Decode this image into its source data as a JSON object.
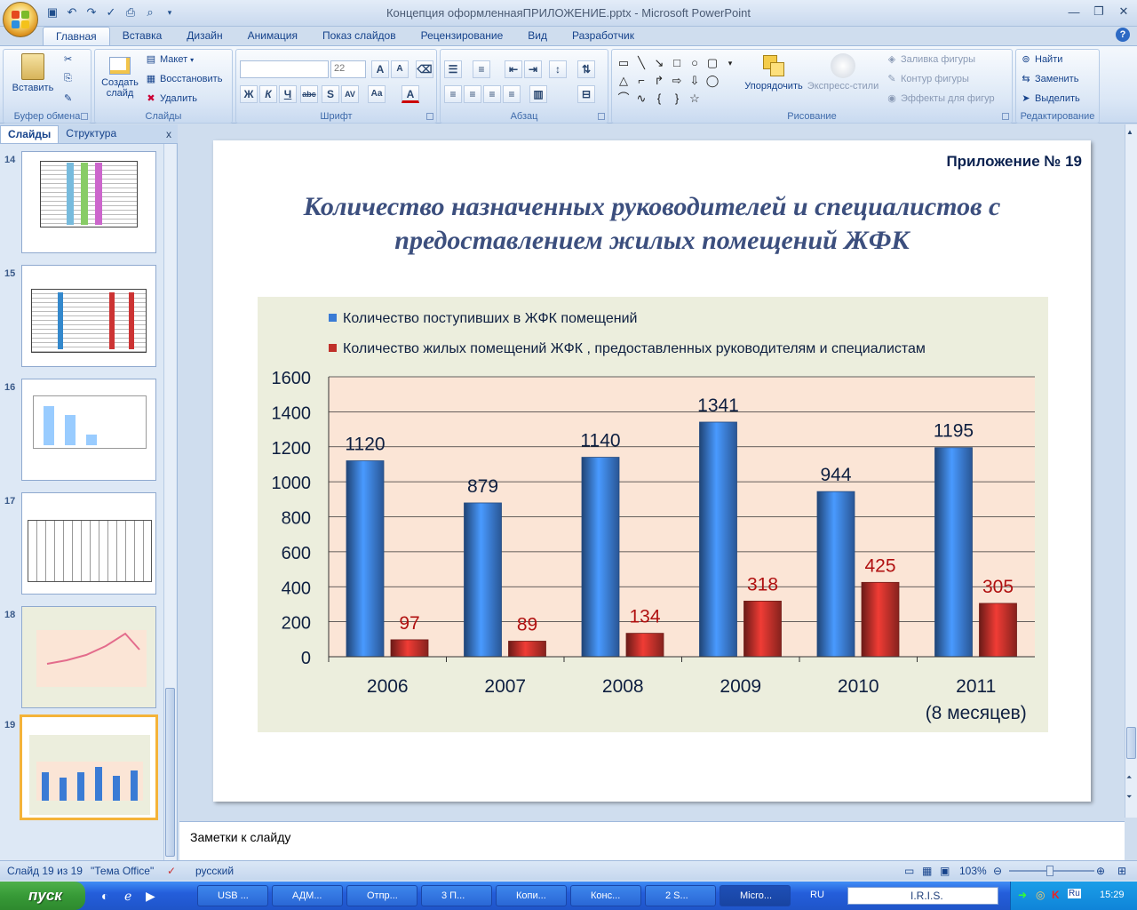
{
  "window": {
    "title": "Концепция оформленнаяПРИЛОЖЕНИЕ.pptx - Microsoft PowerPoint"
  },
  "ribbon_tabs": [
    "Главная",
    "Вставка",
    "Дизайн",
    "Анимация",
    "Показ слайдов",
    "Рецензирование",
    "Вид",
    "Разработчик"
  ],
  "ribbon": {
    "clipboard": {
      "paste": "Вставить",
      "label": "Буфер обмена"
    },
    "slides": {
      "create": "Создать",
      "create2": "слайд",
      "layout": "Макет",
      "reset": "Восстановить",
      "delete": "Удалить",
      "label": "Слайды"
    },
    "font": {
      "size": "22",
      "label": "Шрифт"
    },
    "paragraph": {
      "label": "Абзац"
    },
    "drawing": {
      "arrange": "Упорядочить",
      "quick_styles": "Экспресс-стили",
      "fill": "Заливка фигуры",
      "outline": "Контур фигуры",
      "effects": "Эффекты для фигур",
      "label": "Рисование"
    },
    "editing": {
      "find": "Найти",
      "replace": "Заменить",
      "select": "Выделить",
      "label": "Редактирование"
    }
  },
  "panel": {
    "tab_slides": "Слайды",
    "tab_outline": "Структура",
    "thumbnails": [
      {
        "num": "14"
      },
      {
        "num": "15"
      },
      {
        "num": "16"
      },
      {
        "num": "17"
      },
      {
        "num": "18"
      },
      {
        "num": "19"
      }
    ]
  },
  "slide": {
    "appendix": "Приложение № 19",
    "title_line1": "Количество назначенных руководителей и специалистов с",
    "title_line2": "предоставлением жилых помещений ЖФК"
  },
  "chart_data": {
    "type": "bar",
    "categories": [
      "2006",
      "2007",
      "2008",
      "2009",
      "2010",
      "2011"
    ],
    "category_sublabels": [
      "",
      "",
      "",
      "",
      "",
      "(8 месяцев)"
    ],
    "series": [
      {
        "name": "Количество поступивших в ЖФК помещений",
        "values": [
          1120,
          879,
          1140,
          1341,
          944,
          1195
        ],
        "color": "#3a7bd5"
      },
      {
        "name": "Количество жилых помещений  ЖФК , предоставленных  руководителям и специалистам",
        "values": [
          97,
          89,
          134,
          318,
          425,
          305
        ],
        "color": "#c0302a"
      }
    ],
    "yticks": [
      "0",
      "200",
      "400",
      "600",
      "800",
      "1000",
      "1200",
      "1400",
      "1600"
    ],
    "ylim": [
      0,
      1600
    ],
    "legend": "top",
    "grid": true
  },
  "notes": {
    "placeholder": "Заметки к слайду"
  },
  "status": {
    "slide_info": "Слайд 19 из 19",
    "theme": "\"Тема Office\"",
    "lang": "русский",
    "zoom": "103%"
  },
  "taskbar": {
    "start": "пуск",
    "tasks": [
      "USB ...",
      "АДМ...",
      "Отпр...",
      "3 П...",
      "Копи...",
      "Конс...",
      "2 S...",
      "Micro..."
    ],
    "lang": "RU",
    "iris": "I.R.I.S.",
    "clock": "15:29"
  }
}
